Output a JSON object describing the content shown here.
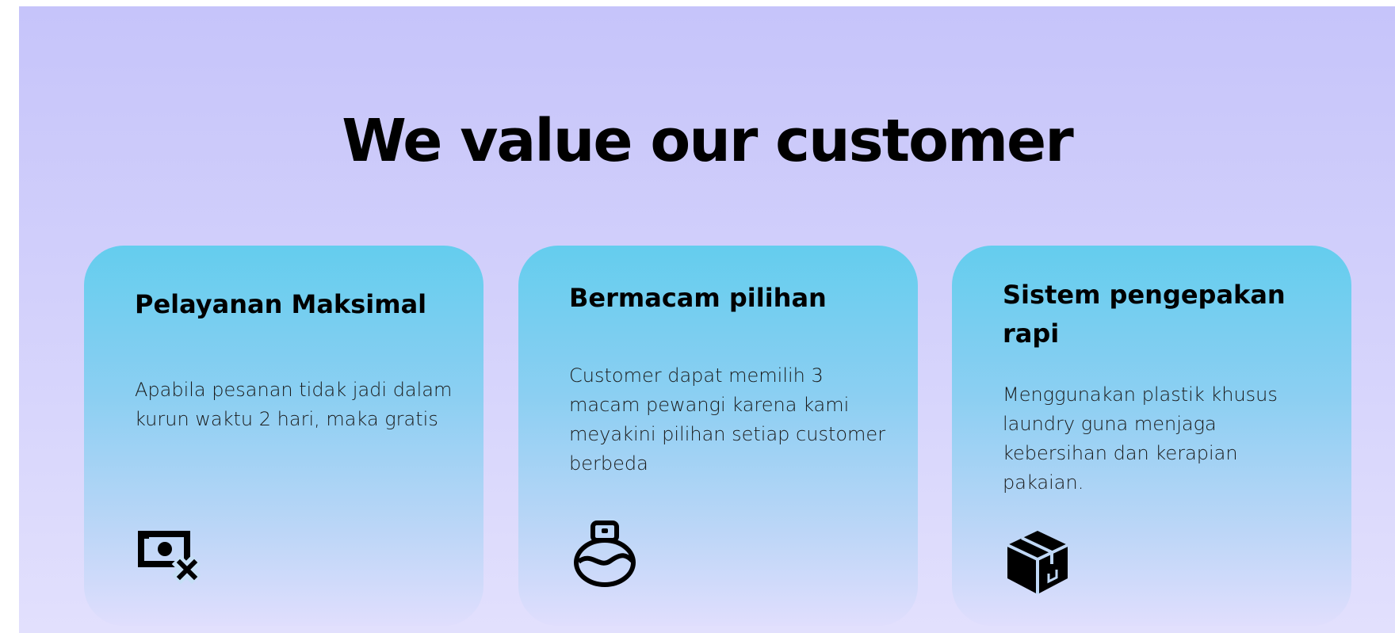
{
  "section": {
    "title": "We value our customer"
  },
  "cards": [
    {
      "title": "Pelayanan Maksimal",
      "description": "Apabila pesanan tidak jadi dalam kurun waktu 2 hari, maka gratis",
      "icon": "money-off-icon"
    },
    {
      "title": "Bermacam pilihan",
      "description": "Customer dapat memilih 3 macam pewangi karena kami meyakini pilihan setiap customer berbeda",
      "icon": "perfume-bottle-icon"
    },
    {
      "title": "Sistem pengepakan rapi",
      "description": "Menggunakan plastik khusus laundry guna menjaga kebersihan dan kerapian pakaian.",
      "icon": "package-box-icon"
    }
  ],
  "colors": {
    "background_top": "#c6c4fa",
    "background_bottom": "#e2e0fd",
    "card_top": "#64cdee",
    "card_bottom": "#e0defd",
    "text": "#000000"
  }
}
